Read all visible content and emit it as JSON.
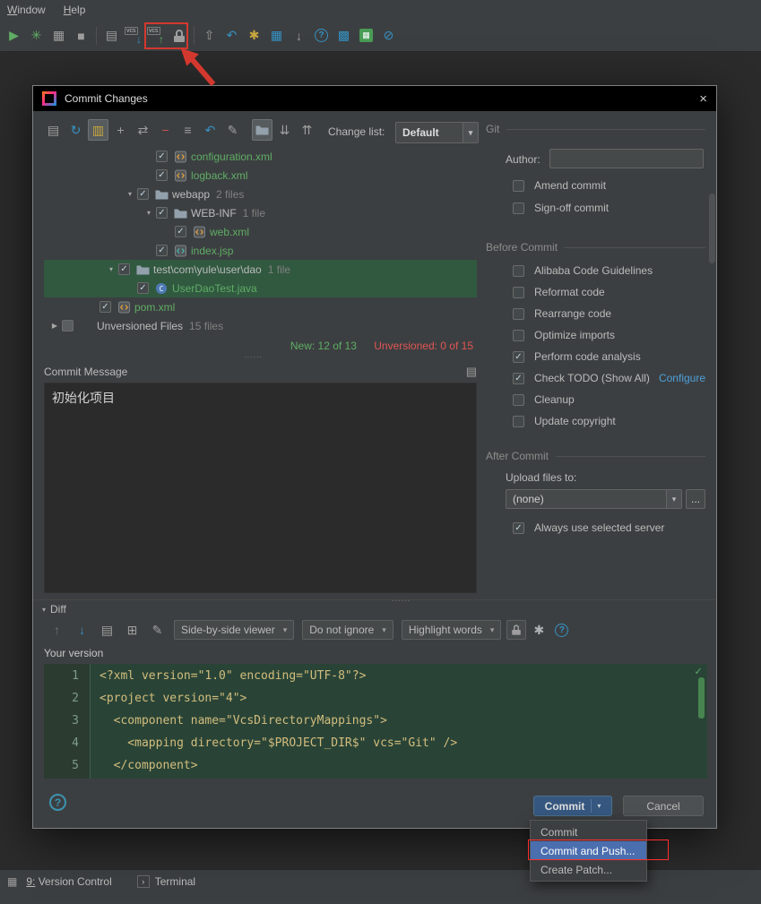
{
  "icons": {
    "close": "×",
    "dropdown": "▾",
    "check": "✓",
    "tri_down": "▾",
    "tri_right": "▶",
    "dots": "∙∙∙∙∙∙",
    "vcs_label": "vcs",
    "history": "▤",
    "gear": "✱",
    "help": "?",
    "terminal": "›",
    "tool_windows": "▦"
  },
  "menu": {
    "window": "Window",
    "help": "Help"
  },
  "toolbar": {
    "icons": [
      {
        "name": "run-icon",
        "glyph": "▶",
        "color": "#5FAD65"
      },
      {
        "name": "debug-icon",
        "glyph": "✳",
        "color": "#5FAD65"
      },
      {
        "name": "coverage-icon",
        "glyph": "▦",
        "color": "#9E9E9E"
      },
      {
        "name": "stop-icon",
        "glyph": "■",
        "color": "#9E9E9E"
      },
      {
        "sep": true
      },
      {
        "name": "paste-icon",
        "glyph": "▤",
        "color": "#9E9E9E"
      },
      {
        "name": "update-project-icon",
        "vcs": "down",
        "glyph": "↓",
        "color": "#3592C4"
      },
      {
        "name": "commit-changes-icon",
        "vcs": "up",
        "glyph": "↑",
        "color": "#5FAD65"
      },
      {
        "name": "lock-icon",
        "lock": true
      },
      {
        "sep": true
      },
      {
        "name": "shelve-icon",
        "glyph": "⇧",
        "color": "#9E9E9E"
      },
      {
        "name": "undo-icon",
        "glyph": "↶",
        "color": "#3592C4"
      },
      {
        "name": "tools-icon",
        "glyph": "✱",
        "color": "#C9A73F"
      },
      {
        "name": "structure-icon",
        "glyph": "▦",
        "color": "#3592C4"
      },
      {
        "name": "download-icon",
        "glyph": "↓",
        "color": "#9E9E9E"
      },
      {
        "name": "help-icon",
        "glyph": "?",
        "circle": true,
        "color": "#3592C4"
      },
      {
        "name": "plugins-icon",
        "glyph": "▩",
        "color": "#3592C4"
      },
      {
        "name": "marketplace-icon",
        "glyph": "▦",
        "box": true,
        "color": "#499C54"
      },
      {
        "name": "block-icon",
        "glyph": "⊘",
        "color": "#3592C4"
      }
    ]
  },
  "dialog": {
    "title": "Commit Changes",
    "toolbar": {
      "changelist_label": "Change list:",
      "changelist_value": "Default",
      "icons": [
        {
          "name": "show-details-icon",
          "glyph": "▤",
          "color": "#9E9E9E"
        },
        {
          "name": "refresh-icon",
          "glyph": "↻",
          "color": "#3592C4"
        },
        {
          "name": "show-diff-icon",
          "glyph": "▥",
          "color": "#C9A73F",
          "active": true
        },
        {
          "name": "add-icon",
          "glyph": "+",
          "color": "#9E9E9E"
        },
        {
          "name": "move-to-changelist-icon",
          "glyph": "⇄",
          "color": "#9E9E9E"
        },
        {
          "name": "delete-icon",
          "glyph": "−",
          "color": "#C75450"
        },
        {
          "name": "changelist-icon",
          "glyph": "≡",
          "color": "#9E9E9E"
        },
        {
          "name": "rollback-icon",
          "glyph": "↶",
          "color": "#3592C4"
        },
        {
          "name": "edit-icon",
          "glyph": "✎",
          "color": "#9E9E9E"
        },
        {
          "gap": true
        },
        {
          "name": "group-by-directory-icon",
          "folder": true,
          "active": true
        },
        {
          "name": "expand-all-icon",
          "glyph": "⇊",
          "color": "#9E9E9E"
        },
        {
          "name": "collapse-all-icon",
          "glyph": "⇈",
          "color": "#9E9E9E"
        }
      ]
    },
    "tree": {
      "rows": [
        {
          "indent": 5,
          "arrow": null,
          "checked": true,
          "icon": "xml",
          "name": "configuration.xml",
          "cls": "green"
        },
        {
          "indent": 5,
          "arrow": null,
          "checked": true,
          "icon": "xml",
          "name": "logback.xml",
          "cls": "green"
        },
        {
          "indent": 4,
          "arrow": "down",
          "checked": true,
          "icon": "folder",
          "name": "webapp",
          "meta": "2 files",
          "cls": "white"
        },
        {
          "indent": 5,
          "arrow": "down",
          "checked": true,
          "icon": "folder",
          "name": "WEB-INF",
          "meta": "1 file",
          "cls": "white"
        },
        {
          "indent": 6,
          "arrow": null,
          "checked": true,
          "icon": "xml",
          "name": "web.xml",
          "cls": "green"
        },
        {
          "indent": 5,
          "arrow": null,
          "checked": true,
          "icon": "jsp",
          "name": "index.jsp",
          "cls": "green"
        },
        {
          "indent": 3,
          "arrow": "down",
          "checked": true,
          "icon": "folder",
          "name": "test\\com\\yule\\user\\dao",
          "meta": "1 file",
          "cls": "white",
          "selected": true
        },
        {
          "indent": 4,
          "arrow": null,
          "checked": true,
          "icon": "java",
          "name": "UserDaoTest.java",
          "cls": "green",
          "selected": true
        },
        {
          "indent": 2,
          "arrow": null,
          "checked": true,
          "icon": "xml",
          "name": "pom.xml",
          "cls": "green"
        },
        {
          "indent": 0,
          "arrow": "right",
          "checked": false,
          "dim": true,
          "icon": null,
          "name": "Unversioned Files",
          "meta": "15 files",
          "cls": "white"
        }
      ]
    },
    "stats": {
      "new_text": "New: 12 of 13",
      "unversioned_text": "Unversioned: 0 of 15"
    },
    "message": {
      "label": "Commit Message",
      "text": "初始化项目"
    },
    "git": {
      "header": "Git",
      "author_label": "Author:",
      "author_value": "",
      "amend_label": "Amend commit",
      "signoff_label": "Sign-off commit"
    },
    "before": {
      "header": "Before Commit",
      "options": [
        {
          "label": "Alibaba Code Guidelines",
          "checked": false
        },
        {
          "label": "Reformat code",
          "checked": false
        },
        {
          "label": "Rearrange code",
          "checked": false
        },
        {
          "label": "Optimize imports",
          "checked": false
        },
        {
          "label": "Perform code analysis",
          "checked": true
        },
        {
          "label": "Check TODO (Show All)",
          "checked": true,
          "link": "Configure"
        },
        {
          "label": "Cleanup",
          "checked": false
        },
        {
          "label": "Update copyright",
          "checked": false
        }
      ]
    },
    "after": {
      "header": "After Commit",
      "upload_label": "Upload files to:",
      "upload_value": "(none)",
      "browse_label": "...",
      "always_label": "Always use selected server",
      "always_checked": true
    },
    "diff": {
      "header": "Diff",
      "icons": [
        {
          "name": "prev-diff-icon",
          "glyph": "↑",
          "color": "#6F7375"
        },
        {
          "name": "next-diff-icon",
          "glyph": "↓",
          "color": "#3592C4"
        },
        {
          "name": "jump-to-source-icon",
          "glyph": "▤",
          "color": "#9E9E9E"
        },
        {
          "name": "apply-diff-icon",
          "glyph": "⊞",
          "color": "#9E9E9E"
        },
        {
          "name": "annotate-icon",
          "glyph": "✎",
          "color": "#9E9E9E"
        }
      ],
      "viewer_value": "Side-by-side viewer",
      "ignore_value": "Do not ignore",
      "highlight_value": "Highlight words",
      "your_version_label": "Your version",
      "lines": [
        "<?xml version=\"1.0\" encoding=\"UTF-8\"?>",
        "<project version=\"4\">",
        "  <component name=\"VcsDirectoryMappings\">",
        "    <mapping directory=\"$PROJECT_DIR$\" vcs=\"Git\" />",
        "  </component>"
      ]
    },
    "buttons": {
      "commit": "Commit",
      "cancel": "Cancel"
    }
  },
  "popup": {
    "items": [
      {
        "label": "Commit",
        "selected": false
      },
      {
        "label": "Commit and Push...",
        "selected": true
      },
      {
        "label": "Create Patch...",
        "selected": false
      }
    ]
  },
  "statusbar": {
    "version_control": "9: Version Control",
    "terminal": "Terminal"
  },
  "colors": {
    "added_green": "#5FAD65",
    "unversioned_red": "#E05555",
    "link_blue": "#4DA1DB",
    "selection_green": "#315940",
    "accent_blue": "#3592C4",
    "annotation_red": "#D3382E"
  }
}
